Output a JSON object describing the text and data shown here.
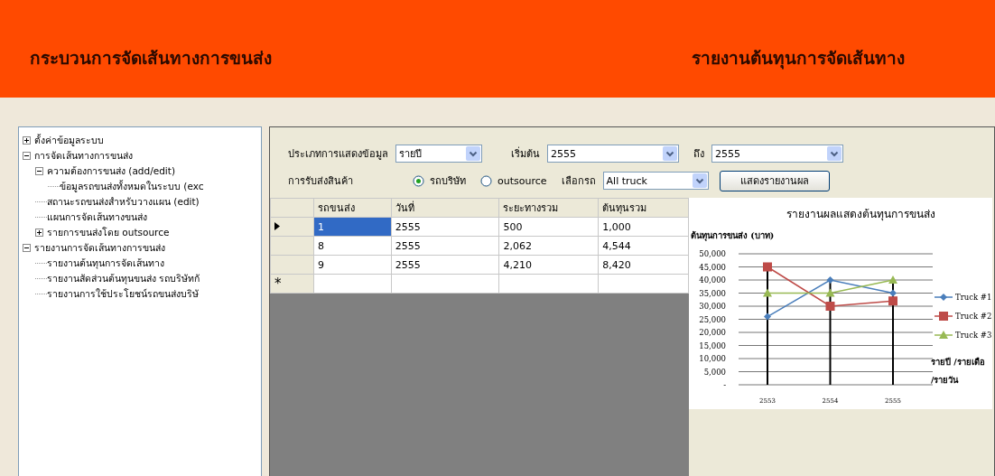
{
  "header": {
    "title": "กระบวนการจัดเส้นทางการขนส่ง",
    "page_title": "รายงานต้นทุนการจัดเส้นทาง"
  },
  "tree": [
    {
      "label": "ตั้งค่าข้อมูลระบบ",
      "expanded": false
    },
    {
      "label": "การจัดเส้นทางการขนส่ง",
      "expanded": true,
      "children": [
        {
          "label": "ความต้องการขนส่ง (add/edit)",
          "expanded": true,
          "children": [
            {
              "label": "ข้อมูลรถขนส่งทั้งหมดในระบบ (exc"
            }
          ]
        },
        {
          "label": "สถานะรถขนส่งสำหรับวางแผน (edit)"
        },
        {
          "label": "แผนการจัดเส้นทางขนส่ง"
        },
        {
          "label": "รายการขนส่งโดย outsource",
          "expanded": false
        }
      ]
    },
    {
      "label": "รายงานการจัดเส้นทางการขนส่ง",
      "expanded": true,
      "children": [
        {
          "label": "รายงานต้นทุนการจัดเส้นทาง"
        },
        {
          "label": "รายงานสัดส่วนต้นทุนขนส่ง รถบริษัทกั"
        },
        {
          "label": "รายงานการใช้ประโยชน์รถขนส่งบริษั"
        }
      ]
    }
  ],
  "filters": {
    "display_type": {
      "label": "ประเภทการแสดงข้อมูล",
      "value": "รายปี"
    },
    "start": {
      "label": "เริ่มต้น",
      "value": "2555"
    },
    "end": {
      "label": "ถึง",
      "value": "2555"
    }
  },
  "delivery": {
    "label": "การรับส่งสินค้า",
    "options": [
      {
        "label": "รถบริษัท",
        "selected": true
      },
      {
        "label": "outsource",
        "selected": false
      }
    ],
    "truck": {
      "label": "เลือกรถ",
      "value": "All truck"
    },
    "button": "แสดงรายงานผล"
  },
  "table": {
    "columns": [
      "รถขนส่ง",
      "วันที่",
      "ระยะทางรวม",
      "ต้นทุนรวม"
    ],
    "rows": [
      {
        "cells": [
          "1",
          "2555",
          "500",
          "1,000"
        ],
        "selected": true
      },
      {
        "cells": [
          "8",
          "2555",
          "2,062",
          "4,544"
        ],
        "selected": false
      },
      {
        "cells": [
          "9",
          "2555",
          "4,210",
          "8,420"
        ],
        "selected": false
      },
      {
        "kind": "new",
        "marker": "*",
        "selected": false
      }
    ]
  },
  "chart_data": {
    "type": "line",
    "title": "รายงานผลแสดงต้นทุนการขนส่ง",
    "ylabel": "ต้นทุนการขนส่ง (บาท)",
    "xlabel": "รายปี /รายเดือ\n/รายวัน",
    "grid": true,
    "legend": true,
    "categories": [
      "2553",
      "2554",
      "2555"
    ],
    "series": [
      {
        "name": "Truck #1",
        "color": "#4a7ebb",
        "marker": "diamond",
        "values": [
          26000,
          40000,
          35000
        ]
      },
      {
        "name": "Truck #2",
        "color": "#be4b48",
        "marker": "square",
        "values": [
          45000,
          30000,
          32000
        ]
      },
      {
        "name": "Truck #3",
        "color": "#98b954",
        "marker": "triangle",
        "values": [
          35000,
          35000,
          40000
        ]
      }
    ],
    "ylim": [
      0,
      50000
    ],
    "yticks": [
      {
        "value": 0,
        "label": "-"
      },
      {
        "value": 5000,
        "label": "5,000"
      },
      {
        "value": 10000,
        "label": "10,000"
      },
      {
        "value": 15000,
        "label": "15,000"
      },
      {
        "value": 20000,
        "label": "20,000"
      },
      {
        "value": 25000,
        "label": "25,000"
      },
      {
        "value": 30000,
        "label": "30,000"
      },
      {
        "value": 35000,
        "label": "35,000"
      },
      {
        "value": 40000,
        "label": "40,000"
      },
      {
        "value": 45000,
        "label": "45,000"
      },
      {
        "value": 50000,
        "label": "50,000"
      }
    ]
  }
}
